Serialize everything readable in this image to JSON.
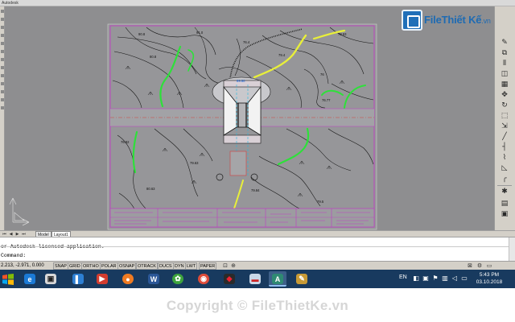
{
  "window": {
    "top_left_text": "Autodesk",
    "top_cells": [
      "",
      "",
      "",
      "",
      ""
    ]
  },
  "logo": {
    "brand": "File",
    "rest": "Thiết Kế",
    "suffix": ".vn"
  },
  "drawing": {
    "elevations": [
      "90.8",
      "91.0",
      "80.8",
      "78.63",
      "76.4",
      "89.50",
      "76",
      "79.4",
      "76.77",
      "80.63",
      "79.63",
      "79.84",
      "79.5",
      "76.82"
    ],
    "title_block_cells": [
      "",
      "",
      "",
      "",
      "",
      ""
    ]
  },
  "layout_tabs": {
    "arrows": [
      "⏮",
      "◀",
      "▶",
      "⏭"
    ],
    "tabs": [
      "Model",
      "Layout1"
    ]
  },
  "command": {
    "history": "or Autodesk licensed application.",
    "prompt": "Command:",
    "value": ""
  },
  "status": {
    "coordinates": "2.213, -2.971, 0.000",
    "toggles": [
      "SNAP",
      "GRID",
      "ORTHO",
      "POLAR",
      "OSNAP",
      "OTRACK",
      "DUCS",
      "DYN",
      "LWT",
      "PAPER"
    ]
  },
  "taskbar": {
    "apps": [
      "ie",
      "explorer",
      "files",
      "media",
      "firefox",
      "word",
      "wings",
      "chrome",
      "app-red",
      "app-flag",
      "autocad",
      "paint"
    ],
    "language": "EN",
    "time": "5:43 PM",
    "date": "03.10.2018"
  },
  "footer": {
    "copyright": "Copyright © FileThietKe.vn"
  },
  "colors": {
    "canvas": "#8e8e90",
    "paper_border": "#c03cc4",
    "contour": "#101010",
    "highlight_green": "#2ee03a",
    "highlight_yellow": "#e8ef3a",
    "taskbar": "#183a5f"
  }
}
